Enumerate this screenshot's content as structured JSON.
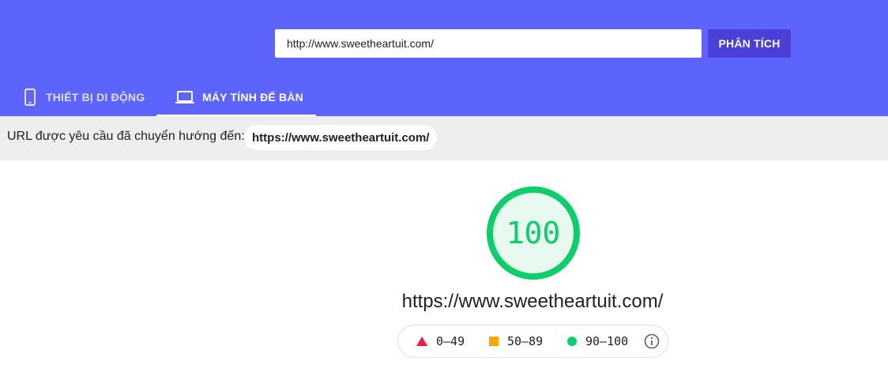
{
  "search": {
    "url_value": "http://www.sweetheartuit.com/",
    "analyze_label": "PHÂN TÍCH"
  },
  "tabs": [
    {
      "label": "THIẾT BỊ DI ĐỘNG",
      "icon": "smartphone-icon",
      "selected": false
    },
    {
      "label": "MÁY TÍNH ĐỂ BÀN",
      "icon": "laptop-icon",
      "selected": true
    }
  ],
  "redirect": {
    "label": "URL được yêu cầu đã chuyển hướng đến:",
    "url": "https://www.sweetheartuit.com/"
  },
  "score": {
    "value": "100",
    "fraction": 1.0,
    "url": "https://www.sweetheartuit.com/"
  },
  "legend": [
    {
      "range": "0–49",
      "icon": "triangle-icon",
      "color": "#ff1744"
    },
    {
      "range": "50–89",
      "icon": "square-icon",
      "color": "#ffa400"
    },
    {
      "range": "90–100",
      "icon": "circle-icon",
      "color": "#0cce6b"
    }
  ],
  "colors": {
    "header_bg": "#5c64fb",
    "button_bg": "#4a3fd6",
    "pass": "#0cce6b",
    "pass_fill": "#e8faef"
  }
}
